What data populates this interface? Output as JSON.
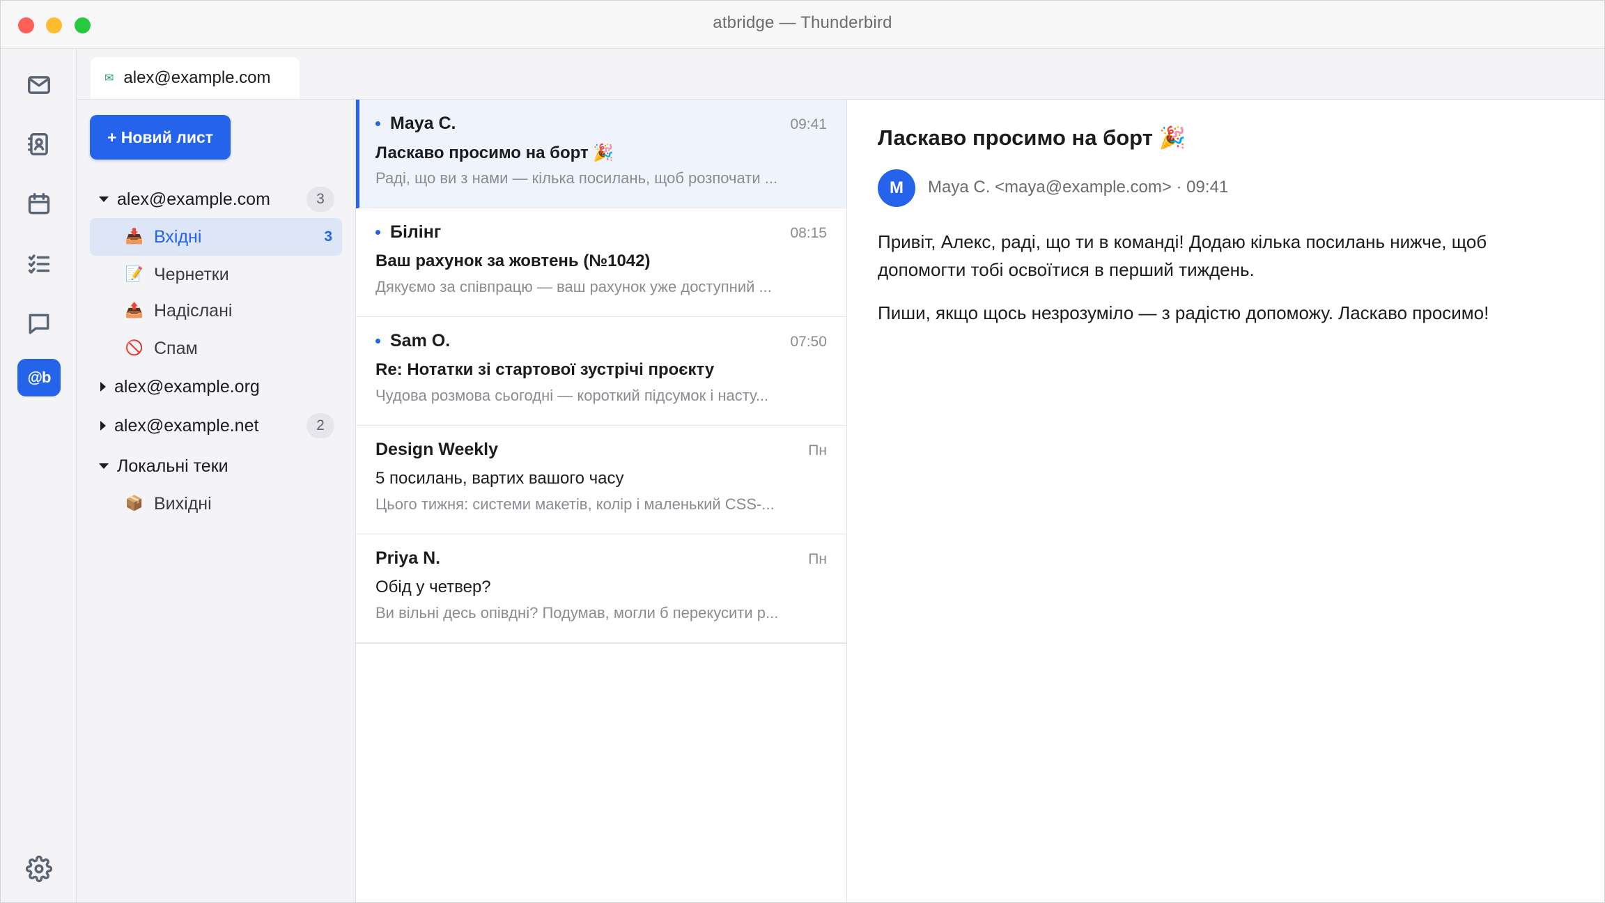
{
  "window": {
    "title": "atbridge — Thunderbird"
  },
  "spaces": [
    {
      "name": "mail-icon"
    },
    {
      "name": "address-book-icon"
    },
    {
      "name": "calendar-icon"
    },
    {
      "name": "tasks-icon"
    },
    {
      "name": "chat-icon"
    },
    {
      "name": "atbridge-icon",
      "label": "@b"
    },
    {
      "name": "settings-icon"
    }
  ],
  "tab": {
    "label": "alex@example.com",
    "icon": "✉"
  },
  "folders": {
    "new_message_label": "+ Новий лист",
    "accounts": [
      {
        "label": "alex@example.com",
        "expanded": true,
        "badge": "3"
      },
      {
        "label": "alex@example.org",
        "expanded": false,
        "badge": ""
      },
      {
        "label": "alex@example.net",
        "expanded": false,
        "badge": "2"
      },
      {
        "label": "Локальні теки",
        "expanded": true,
        "badge": ""
      }
    ],
    "items": [
      {
        "label": "Вхідні",
        "icon": "📥",
        "count": "3"
      },
      {
        "label": "Чернетки",
        "icon": "📝",
        "count": ""
      },
      {
        "label": "Надіслані",
        "icon": "📤",
        "count": ""
      },
      {
        "label": "Спам",
        "icon": "🚫",
        "count": ""
      },
      {
        "label": "Вихідні",
        "icon": "📦",
        "count": ""
      }
    ]
  },
  "messages": [
    {
      "from": "Maya C.",
      "time": "09:41",
      "subject": "Ласкаво просимо на борт 🎉",
      "preview": "Раді, що ви з нами — кілька посилань, щоб розпочати ...",
      "unread": true,
      "selected": true
    },
    {
      "from": "Білінг",
      "time": "08:15",
      "subject": "Ваш рахунок за жовтень (№1042)",
      "preview": "Дякуємо за співпрацю — ваш рахунок уже доступний ...",
      "unread": true,
      "selected": false
    },
    {
      "from": "Sam O.",
      "time": "07:50",
      "subject": "Re: Нотатки зі стартової зустрічі проєкту",
      "preview": "Чудова розмова сьогодні — короткий підсумок і насту...",
      "unread": true,
      "selected": false
    },
    {
      "from": "Design Weekly",
      "time": "Пн",
      "subject": "5 посилань, вартих вашого часу",
      "preview": "Цього тижня: системи макетів, колір і маленький CSS-...",
      "unread": false,
      "selected": false
    },
    {
      "from": "Priya N.",
      "time": "Пн",
      "subject": "Обід у четвер?",
      "preview": "Ви вільні десь опівдні? Подумав, могли б перекусити р...",
      "unread": false,
      "selected": false
    }
  ],
  "reader": {
    "subject": "Ласкаво просимо на борт 🎉",
    "avatar_initial": "M",
    "meta": "Maya C. <maya@example.com> · 09:41",
    "body": [
      "Привіт, Алекс, раді, що ти в команді! Додаю кілька посилань нижче, щоб допомогти тобі освоїтися в перший тиждень.",
      "Пиши, якщо щось незрозуміло — з радістю допоможу. Ласкаво просимо!"
    ]
  },
  "colors": {
    "accent": "#2563eb",
    "selected_bg": "#eef3fc",
    "pane_bg": "#f4f4f6"
  }
}
